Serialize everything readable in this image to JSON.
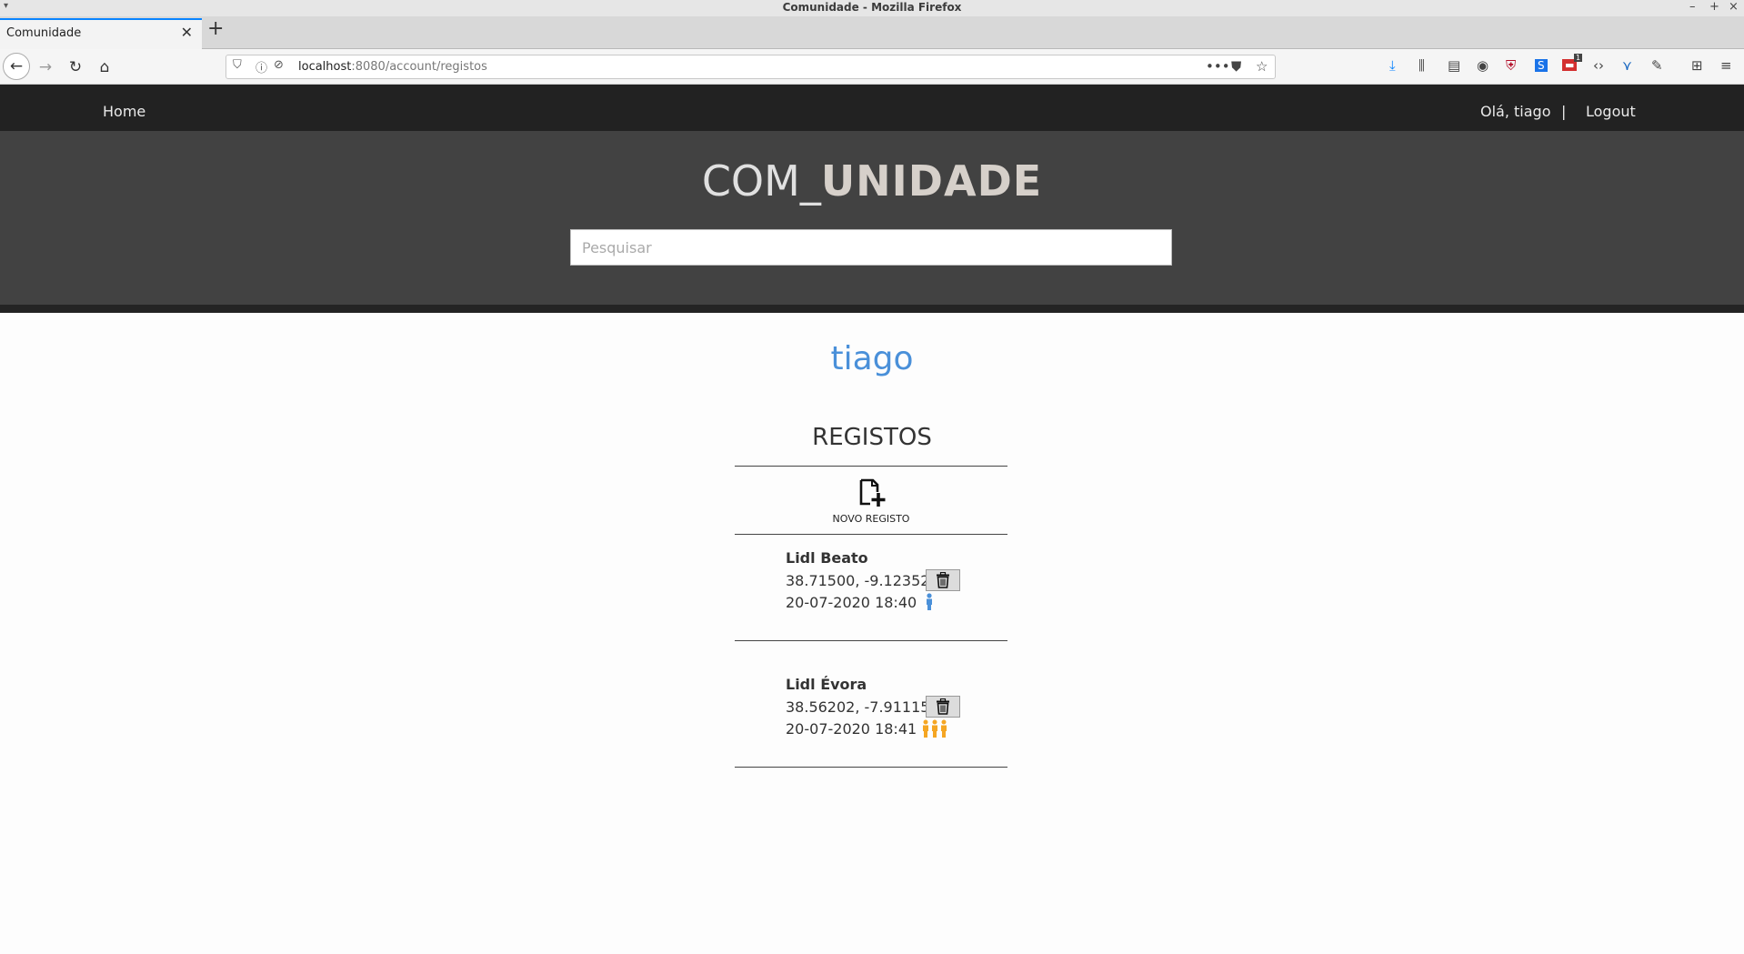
{
  "window": {
    "title": "Comunidade - Mozilla Firefox",
    "controls": [
      "–",
      "+",
      "×"
    ]
  },
  "browser": {
    "tab_title": "Comunidade",
    "url_host": "localhost",
    "url_path": ":8080/account/registos",
    "notification_badge": "1"
  },
  "site": {
    "nav_home": "Home",
    "greeting": "Olá, tiago",
    "separator": "|",
    "logout": "Logout",
    "brand_prefix": "COM_",
    "brand_main": "UNIDADE",
    "search_placeholder": "Pesquisar"
  },
  "page": {
    "username": "tiago",
    "section_title": "REGISTOS",
    "new_record_label": "NOVO REGISTO"
  },
  "registos": [
    {
      "name": "Lidl Beato",
      "coords": "38.71500, -9.12352",
      "datetime": "20-07-2020 18:40",
      "people_icon": "single-person-icon",
      "people_count": 1,
      "people_color": "#4a90d9"
    },
    {
      "name": "Lidl Évora",
      "coords": "38.56202, -7.91115",
      "datetime": "20-07-2020 18:41",
      "people_icon": "group-people-icon",
      "people_count": 3,
      "people_color": "#f5a623"
    }
  ],
  "colors": {
    "accent": "#4a90d9",
    "header_dark": "#222222",
    "hero": "#424242"
  }
}
